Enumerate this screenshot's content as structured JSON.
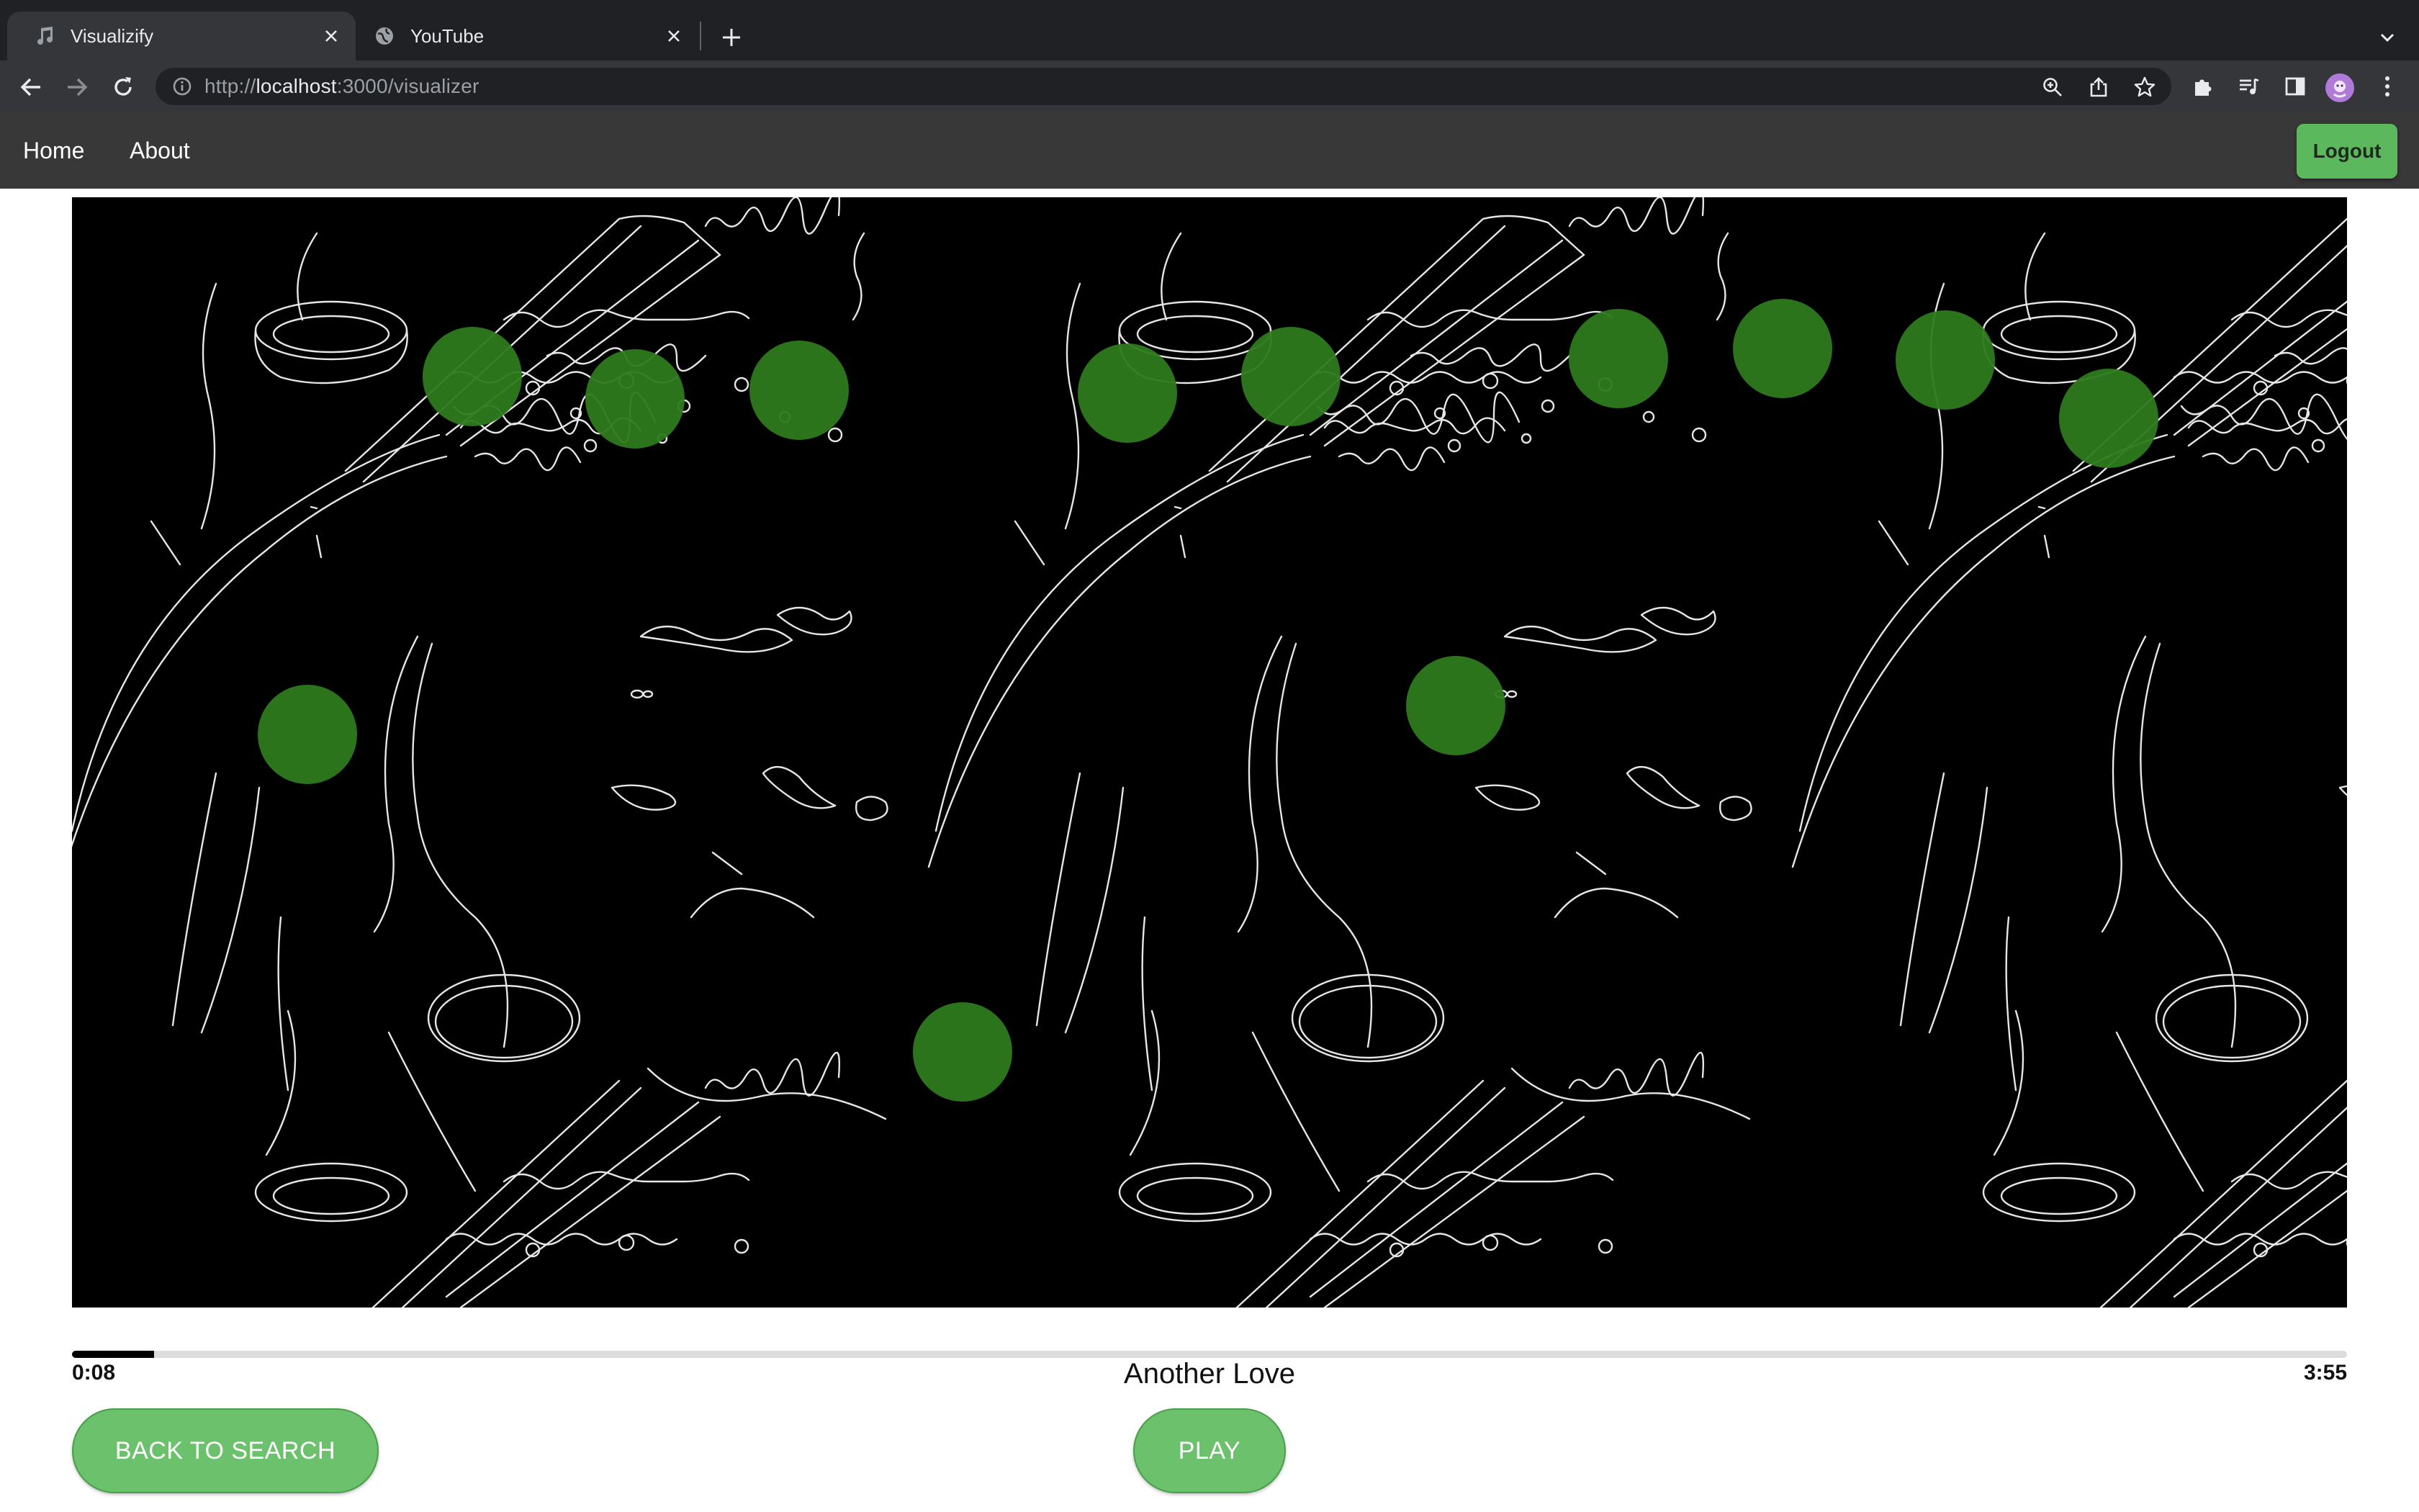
{
  "browser": {
    "tabs": [
      {
        "title": "Visualizify",
        "icon": "music-note-icon",
        "active": true
      },
      {
        "title": "YouTube",
        "icon": "globe-icon",
        "active": false
      }
    ],
    "url_scheme": "http://",
    "url_host": "localhost",
    "url_path": ":3000/visualizer"
  },
  "nav": {
    "links": [
      {
        "label": "Home"
      },
      {
        "label": "About"
      }
    ],
    "logout_label": "Logout"
  },
  "player": {
    "current_time": "0:08",
    "total_time": "3:55",
    "song_title": "Another Love",
    "progress_fraction": 0.036,
    "back_label": "BACK TO SEARCH",
    "play_label": "PLAY"
  },
  "colors": {
    "accent": "#5cb85c",
    "button_green": "#6cc16c",
    "blob_green": "#2e7a1c",
    "nav_bg": "#383838",
    "canvas_bg": "#000000"
  }
}
